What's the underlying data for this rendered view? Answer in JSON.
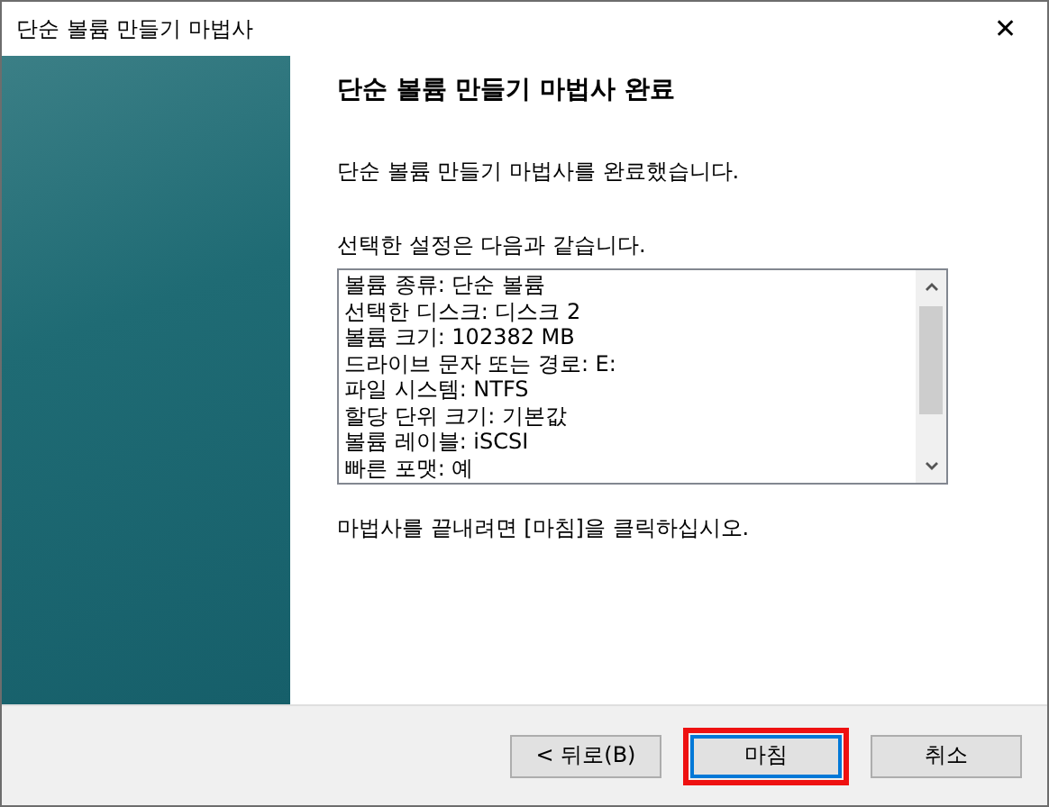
{
  "window": {
    "title": "단순 볼륨 만들기 마법사",
    "close": "✕"
  },
  "heading": "단순 볼륨 만들기 마법사 완료",
  "intro": "단순 볼륨 만들기 마법사를 완료했습니다.",
  "settings_label": "선택한 설정은 다음과 같습니다.",
  "settings": [
    "볼륨 종류: 단순 볼륨",
    "선택한 디스크: 디스크 2",
    "볼륨 크기: 102382 MB",
    "드라이브 문자 또는 경로: E:",
    "파일 시스템: NTFS",
    "할당 단위 크기: 기본값",
    "볼륨 레이블: iSCSI",
    "빠른 포맷: 예"
  ],
  "outro": "마법사를 끝내려면 [마침]을 클릭하십시오.",
  "buttons": [
    {
      "label": "< 뒤로(B)",
      "focused": false,
      "highlighted": false
    },
    {
      "label": "마침",
      "focused": true,
      "highlighted": true
    },
    {
      "label": "취소",
      "focused": false,
      "highlighted": false
    }
  ]
}
